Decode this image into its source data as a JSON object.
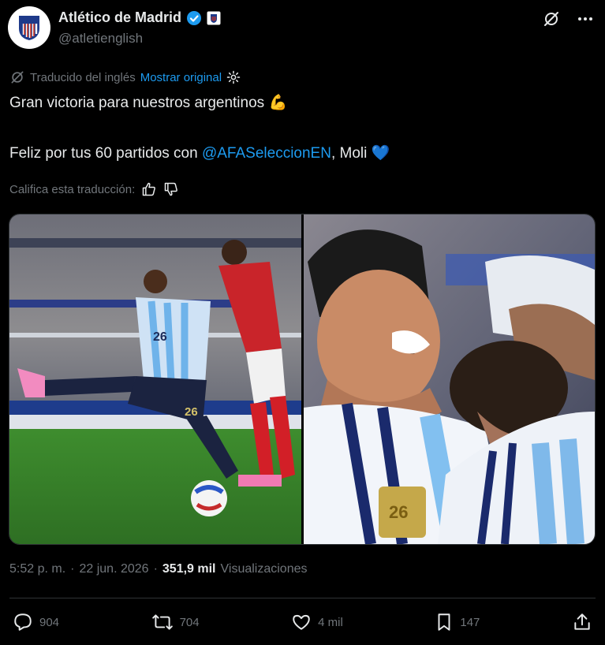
{
  "account": {
    "name": "Atlético de Madrid",
    "handle": "@atletienglish"
  },
  "translation": {
    "label": "Traducido del inglés",
    "show_original": "Mostrar original"
  },
  "tweet": {
    "line1": "Gran victoria para nuestros argentinos",
    "line1_emoji": "💪",
    "line2_prefix": "Feliz por tus 60 partidos con ",
    "mention": "@AFASeleccionEN",
    "line2_suffix": ", Moli",
    "line2_emoji": "💙"
  },
  "rate": {
    "label": "Califica esta traducción:"
  },
  "meta": {
    "time": "5:52 p. m.",
    "separator": "·",
    "date": "22 jun. 2026",
    "views_count": "351,9 mil",
    "views_label": "Visualizaciones"
  },
  "actions": {
    "replies": "904",
    "reposts": "704",
    "likes": "4 mil",
    "bookmarks": "147"
  },
  "colors": {
    "accent": "#1d9bf0",
    "muted": "#71767b",
    "text": "#e7e9ea",
    "verified": "#1d9bf0"
  }
}
